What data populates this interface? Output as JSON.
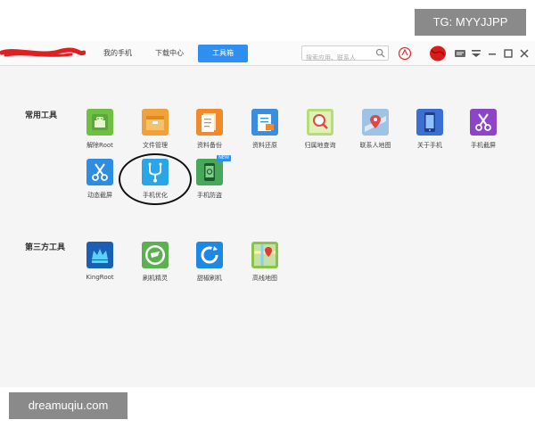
{
  "watermarks": {
    "top": "TG: MYYJJPP",
    "bottom": "dreamuqiu.com"
  },
  "nav": {
    "tabs": [
      "我的手机",
      "下载中心",
      "工具箱"
    ],
    "active": "工具箱"
  },
  "search": {
    "placeholder": "搜索应用、联系人"
  },
  "sections": {
    "common": {
      "title": "常用工具",
      "items": [
        {
          "label": "解除Root",
          "icon": "android-icon",
          "color": "#6fbf45"
        },
        {
          "label": "文件管理",
          "icon": "folder-icon",
          "color": "#f1a13a"
        },
        {
          "label": "资料备份",
          "icon": "document-icon",
          "color": "#f08a2b"
        },
        {
          "label": "资料还原",
          "icon": "restore-icon",
          "color": "#3b8de0"
        },
        {
          "label": "归属地查询",
          "icon": "search-location-icon",
          "color": "#b9dc7a"
        },
        {
          "label": "联系人地图",
          "icon": "map-pin-icon",
          "color": "#9ec3e6"
        },
        {
          "label": "关于手机",
          "icon": "phone-icon",
          "color": "#3b6fd1"
        },
        {
          "label": "手机截屏",
          "icon": "scissors-icon",
          "color": "#8e44c9"
        },
        {
          "label": "动态截屏",
          "icon": "scissors-icon",
          "color": "#2e8de0"
        },
        {
          "label": "手机优化",
          "icon": "stethoscope-icon",
          "color": "#2aa6e8"
        },
        {
          "label": "手机防盗",
          "icon": "anti-theft-icon",
          "color": "#45a85a",
          "badge": "NEW"
        }
      ]
    },
    "third": {
      "title": "第三方工具",
      "items": [
        {
          "label": "KingRoot",
          "icon": "crown-icon",
          "color": "#1a5fb4"
        },
        {
          "label": "刷机精灵",
          "icon": "shield-icon",
          "color": "#5bb04f"
        },
        {
          "label": "甜椒刷机",
          "icon": "refresh-icon",
          "color": "#1e88e5"
        },
        {
          "label": "高线地图",
          "icon": "map-icon",
          "color": "#8bc34a"
        }
      ]
    }
  }
}
